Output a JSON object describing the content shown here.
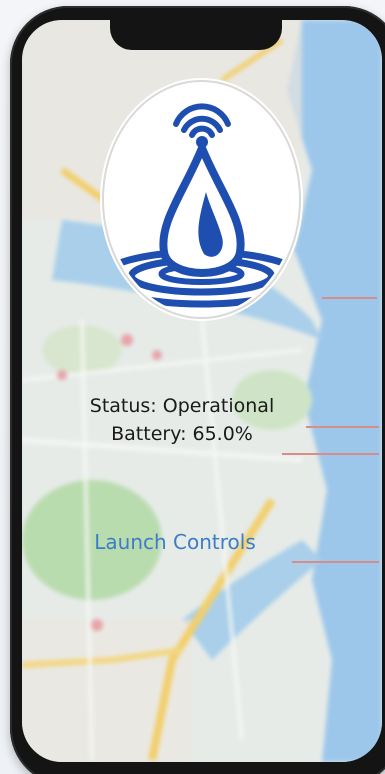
{
  "device": {
    "frame_color": "#141414"
  },
  "screen": {
    "background": "map-image",
    "logo": {
      "icon": "water-drop-signal-icon",
      "color": "#1e4fb0"
    },
    "status_label": "Status: Operational",
    "battery_label": "Battery: 65.0%",
    "launch_link_label": "Launch Controls",
    "link_color": "#3d7cc9"
  }
}
